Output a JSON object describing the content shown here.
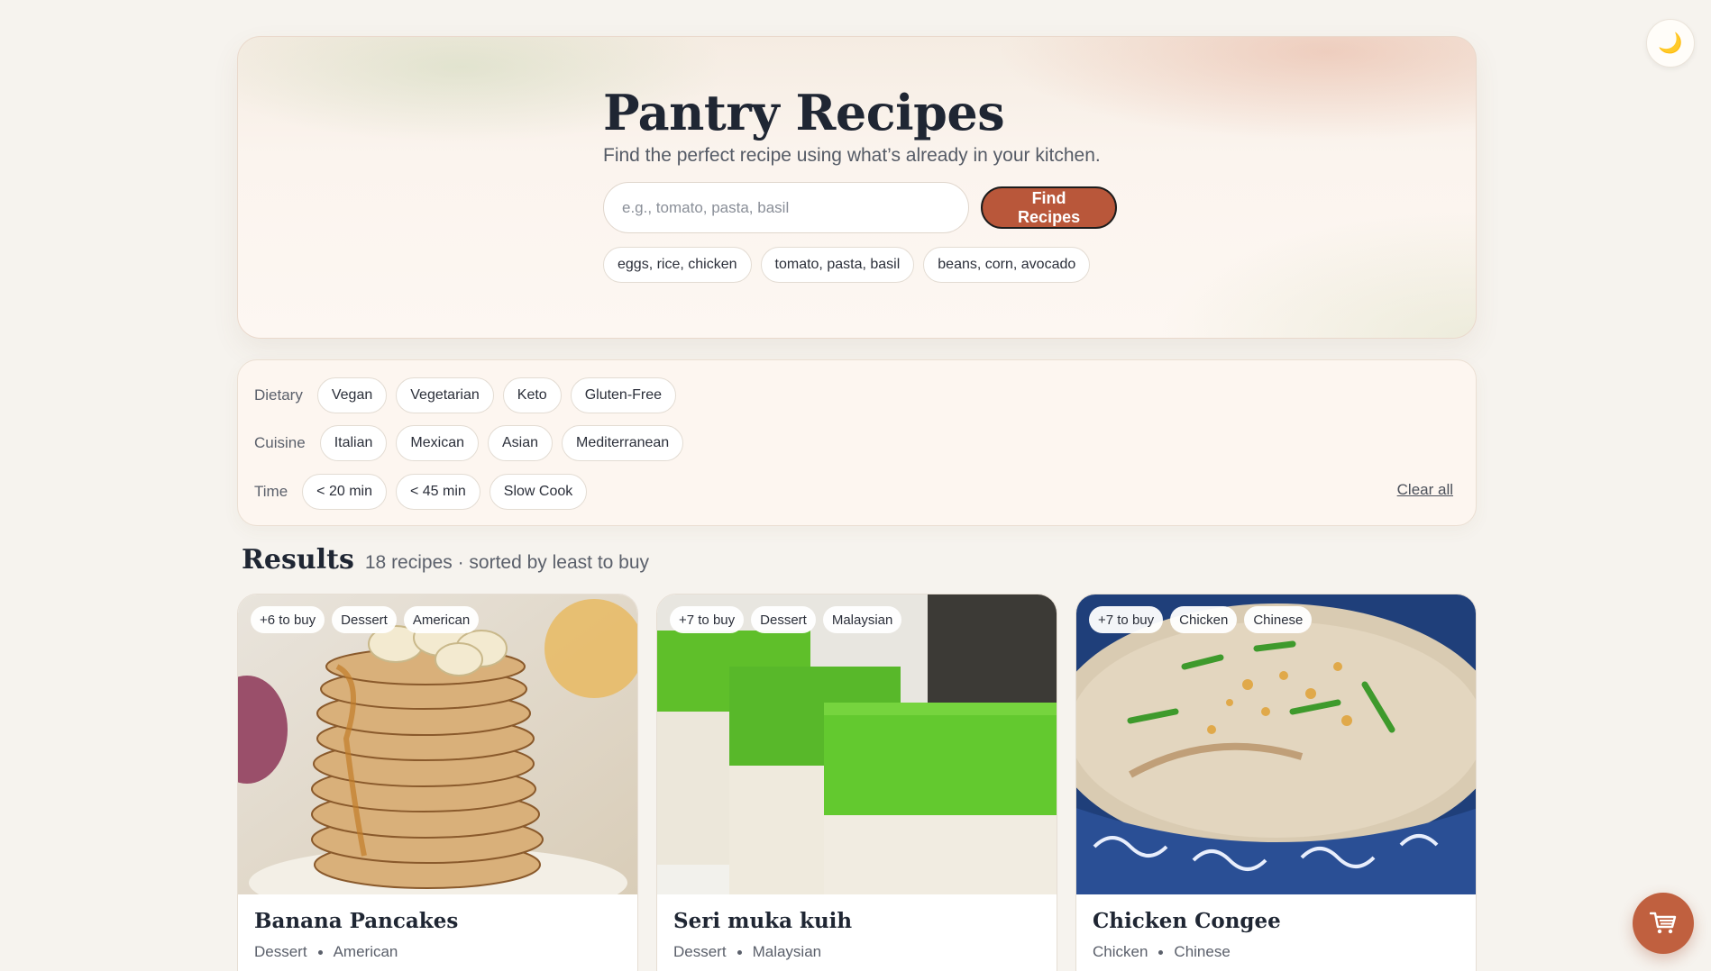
{
  "theme_toggle": {
    "icon": "moon-icon",
    "glyph": "🌙"
  },
  "hero": {
    "title": "Pantry Recipes",
    "subtitle": "Find the perfect recipe using what’s already in your kitchen.",
    "search_placeholder": "e.g., tomato, pasta, basil",
    "search_value": "",
    "find_button": "Find Recipes",
    "suggestions": [
      "eggs, rice, chicken",
      "tomato, pasta, basil",
      "beans, corn, avocado"
    ]
  },
  "filters": {
    "dietary": {
      "label": "Dietary",
      "options": [
        "Vegan",
        "Vegetarian",
        "Keto",
        "Gluten-Free"
      ]
    },
    "cuisine": {
      "label": "Cuisine",
      "options": [
        "Italian",
        "Mexican",
        "Asian",
        "Mediterranean"
      ]
    },
    "time": {
      "label": "Time",
      "options": [
        "< 20 min",
        "< 45 min",
        "Slow Cook"
      ]
    },
    "clear_all": "Clear all"
  },
  "results": {
    "title": "Results",
    "meta": "18 recipes · sorted by least to buy",
    "cards": [
      {
        "title": "Banana Pancakes",
        "badges": [
          "+6 to buy",
          "Dessert",
          "American"
        ],
        "category": "Dessert",
        "cuisine": "American"
      },
      {
        "title": "Seri muka kuih",
        "badges": [
          "+7 to buy",
          "Dessert",
          "Malaysian"
        ],
        "category": "Dessert",
        "cuisine": "Malaysian"
      },
      {
        "title": "Chicken Congee",
        "badges": [
          "+7 to buy",
          "Chicken",
          "Chinese"
        ],
        "category": "Chicken",
        "cuisine": "Chinese"
      }
    ]
  },
  "cart_fab": {
    "icon": "cart-icon"
  },
  "colors": {
    "accent": "#b9573a",
    "background": "#f6f3ee",
    "title": "#1f2633"
  }
}
